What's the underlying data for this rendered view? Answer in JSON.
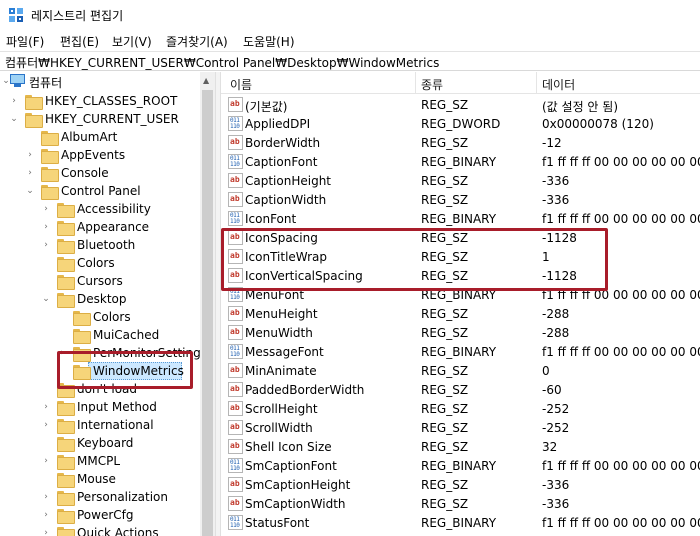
{
  "window": {
    "title": "레지스트리 편집기"
  },
  "menu": [
    "파일(F)",
    "편집(E)",
    "보기(V)",
    "즐겨찾기(A)",
    "도움말(H)"
  ],
  "address": {
    "path": "컴퓨터₩HKEY_CURRENT_USER₩Control Panel₩Desktop₩WindowMetrics"
  },
  "tree": {
    "items": [
      {
        "label": "컴퓨터",
        "level": 0,
        "chevron": "down",
        "icon": "computer-icon"
      },
      {
        "label": "HKEY_CLASSES_ROOT",
        "level": 1,
        "chevron": "right",
        "icon": "folder-icon"
      },
      {
        "label": "HKEY_CURRENT_USER",
        "level": 1,
        "chevron": "down",
        "icon": "folder-icon"
      },
      {
        "label": "AlbumArt",
        "level": 2,
        "chevron": "none",
        "icon": "folder-icon"
      },
      {
        "label": "AppEvents",
        "level": 2,
        "chevron": "right",
        "icon": "folder-icon"
      },
      {
        "label": "Console",
        "level": 2,
        "chevron": "right",
        "icon": "folder-icon"
      },
      {
        "label": "Control Panel",
        "level": 2,
        "chevron": "down",
        "icon": "folder-icon"
      },
      {
        "label": "Accessibility",
        "level": 3,
        "chevron": "right",
        "icon": "folder-icon"
      },
      {
        "label": "Appearance",
        "level": 3,
        "chevron": "right",
        "icon": "folder-icon"
      },
      {
        "label": "Bluetooth",
        "level": 3,
        "chevron": "right",
        "icon": "folder-icon"
      },
      {
        "label": "Colors",
        "level": 3,
        "chevron": "none",
        "icon": "folder-icon"
      },
      {
        "label": "Cursors",
        "level": 3,
        "chevron": "none",
        "icon": "folder-icon"
      },
      {
        "label": "Desktop",
        "level": 3,
        "chevron": "down",
        "icon": "folder-icon"
      },
      {
        "label": "Colors",
        "level": 4,
        "chevron": "none",
        "icon": "folder-icon"
      },
      {
        "label": "MuiCached",
        "level": 4,
        "chevron": "none",
        "icon": "folder-icon"
      },
      {
        "label": "PerMonitorSettings",
        "level": 4,
        "chevron": "right",
        "icon": "folder-icon"
      },
      {
        "label": "WindowMetrics",
        "level": 4,
        "chevron": "none",
        "icon": "folder-icon",
        "selected": true
      },
      {
        "label": "don't load",
        "level": 3,
        "chevron": "none",
        "icon": "folder-icon"
      },
      {
        "label": "Input Method",
        "level": 3,
        "chevron": "right",
        "icon": "folder-icon"
      },
      {
        "label": "International",
        "level": 3,
        "chevron": "right",
        "icon": "folder-icon"
      },
      {
        "label": "Keyboard",
        "level": 3,
        "chevron": "none",
        "icon": "folder-icon"
      },
      {
        "label": "MMCPL",
        "level": 3,
        "chevron": "right",
        "icon": "folder-icon"
      },
      {
        "label": "Mouse",
        "level": 3,
        "chevron": "none",
        "icon": "folder-icon"
      },
      {
        "label": "Personalization",
        "level": 3,
        "chevron": "right",
        "icon": "folder-icon"
      },
      {
        "label": "PowerCfg",
        "level": 3,
        "chevron": "right",
        "icon": "folder-icon"
      },
      {
        "label": "Quick Actions",
        "level": 3,
        "chevron": "right",
        "icon": "folder-icon"
      }
    ]
  },
  "list": {
    "columns": {
      "name": "이름",
      "type": "종류",
      "data": "데이터"
    },
    "rows": [
      {
        "name": "(기본값)",
        "type": "REG_SZ",
        "data": "(값 설정 안 됨)",
        "icon": "string-value-icon"
      },
      {
        "name": "AppliedDPI",
        "type": "REG_DWORD",
        "data": "0x00000078 (120)",
        "icon": "binary-value-icon"
      },
      {
        "name": "BorderWidth",
        "type": "REG_SZ",
        "data": "-12",
        "icon": "string-value-icon"
      },
      {
        "name": "CaptionFont",
        "type": "REG_BINARY",
        "data": "f1 ff ff ff 00 00 00 00 00 00 00",
        "icon": "binary-value-icon"
      },
      {
        "name": "CaptionHeight",
        "type": "REG_SZ",
        "data": "-336",
        "icon": "string-value-icon"
      },
      {
        "name": "CaptionWidth",
        "type": "REG_SZ",
        "data": "-336",
        "icon": "string-value-icon"
      },
      {
        "name": "IconFont",
        "type": "REG_BINARY",
        "data": "f1 ff ff ff 00 00 00 00 00 00 00",
        "icon": "binary-value-icon"
      },
      {
        "name": "IconSpacing",
        "type": "REG_SZ",
        "data": "-1128",
        "icon": "string-value-icon"
      },
      {
        "name": "IconTitleWrap",
        "type": "REG_SZ",
        "data": "1",
        "icon": "string-value-icon"
      },
      {
        "name": "IconVerticalSpacing",
        "type": "REG_SZ",
        "data": "-1128",
        "icon": "string-value-icon"
      },
      {
        "name": "MenuFont",
        "type": "REG_BINARY",
        "data": "f1 ff ff ff 00 00 00 00 00 00 00",
        "icon": "binary-value-icon"
      },
      {
        "name": "MenuHeight",
        "type": "REG_SZ",
        "data": "-288",
        "icon": "string-value-icon"
      },
      {
        "name": "MenuWidth",
        "type": "REG_SZ",
        "data": "-288",
        "icon": "string-value-icon"
      },
      {
        "name": "MessageFont",
        "type": "REG_BINARY",
        "data": "f1 ff ff ff 00 00 00 00 00 00 00",
        "icon": "binary-value-icon"
      },
      {
        "name": "MinAnimate",
        "type": "REG_SZ",
        "data": "0",
        "icon": "string-value-icon"
      },
      {
        "name": "PaddedBorderWidth",
        "type": "REG_SZ",
        "data": "-60",
        "icon": "string-value-icon"
      },
      {
        "name": "ScrollHeight",
        "type": "REG_SZ",
        "data": "-252",
        "icon": "string-value-icon"
      },
      {
        "name": "ScrollWidth",
        "type": "REG_SZ",
        "data": "-252",
        "icon": "string-value-icon"
      },
      {
        "name": "Shell Icon Size",
        "type": "REG_SZ",
        "data": "32",
        "icon": "string-value-icon"
      },
      {
        "name": "SmCaptionFont",
        "type": "REG_BINARY",
        "data": "f1 ff ff ff 00 00 00 00 00 00 00",
        "icon": "binary-value-icon"
      },
      {
        "name": "SmCaptionHeight",
        "type": "REG_SZ",
        "data": "-336",
        "icon": "string-value-icon"
      },
      {
        "name": "SmCaptionWidth",
        "type": "REG_SZ",
        "data": "-336",
        "icon": "string-value-icon"
      },
      {
        "name": "StatusFont",
        "type": "REG_BINARY",
        "data": "f1 ff ff ff 00 00 00 00 00 00 00",
        "icon": "binary-value-icon"
      }
    ]
  },
  "colors": {
    "highlight_border": "#a81d2a",
    "selection_bg": "#cce8ff"
  }
}
